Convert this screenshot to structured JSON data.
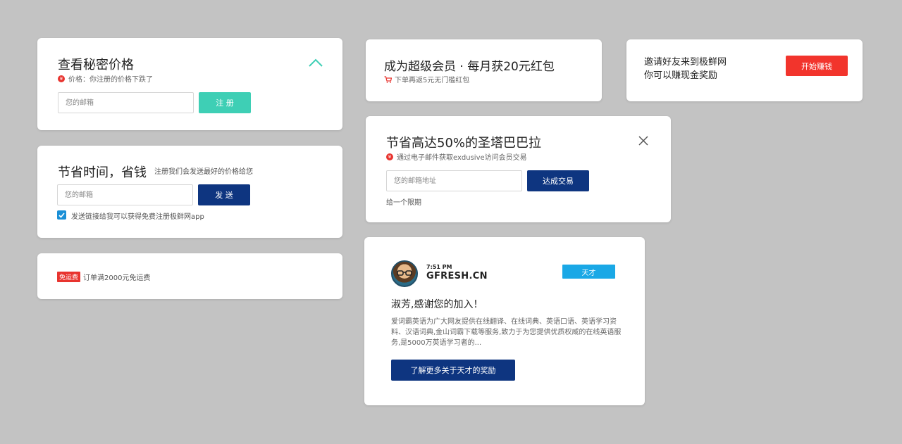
{
  "card1": {
    "title": "查看秘密价格",
    "subtitle": "价格：你注册的价格下跌了",
    "subtitle_icon": "yen-icon",
    "email_placeholder": "您的邮箱",
    "register_label": "注 册",
    "accent": "#3ecfb5"
  },
  "card2": {
    "title": "节省时间，省钱",
    "subtitle": "注册我们会发送最好的价格给您",
    "email_placeholder": "您的邮箱",
    "send_label": "发 送",
    "checkbox_label": "发送链接给我可以获得免费注册极鲜网app",
    "checked": true
  },
  "card3": {
    "tag": "免运费",
    "text": "订单满2000元免运费"
  },
  "card4": {
    "title": "成为超级会员 · 每月获20元红包",
    "subtitle": "下单再返5元无门槛红包",
    "subtitle_icon": "cart-icon"
  },
  "card5": {
    "line1": "邀请好友来到极鲜网",
    "line2": "你可以赚现金奖励",
    "button_label": "开始赚钱",
    "accent": "#f2342c"
  },
  "card6": {
    "title": "节省高达50%的圣塔巴巴拉",
    "subtitle": "通过电子邮件获取exdusive访问会员交易",
    "email_placeholder": "您的邮箱地址",
    "deal_label": "达成交易",
    "limit_text": "给一个限期"
  },
  "card7": {
    "time": "7:51 PM",
    "brand": "GFRESH.CN",
    "badge": "天才",
    "greeting": "淑芳,感谢您的加入！",
    "body": "爱词霸英语为广大网友提供在线翻译、在线词典、英语口语、英语学习资料、汉语词典,金山词霸下载等服务,致力于为您提供优质权威的在线英语服务,是5000万英语学习者的...",
    "cta_label": "了解更多关于天才的奖励",
    "navy": "#0e3580"
  }
}
